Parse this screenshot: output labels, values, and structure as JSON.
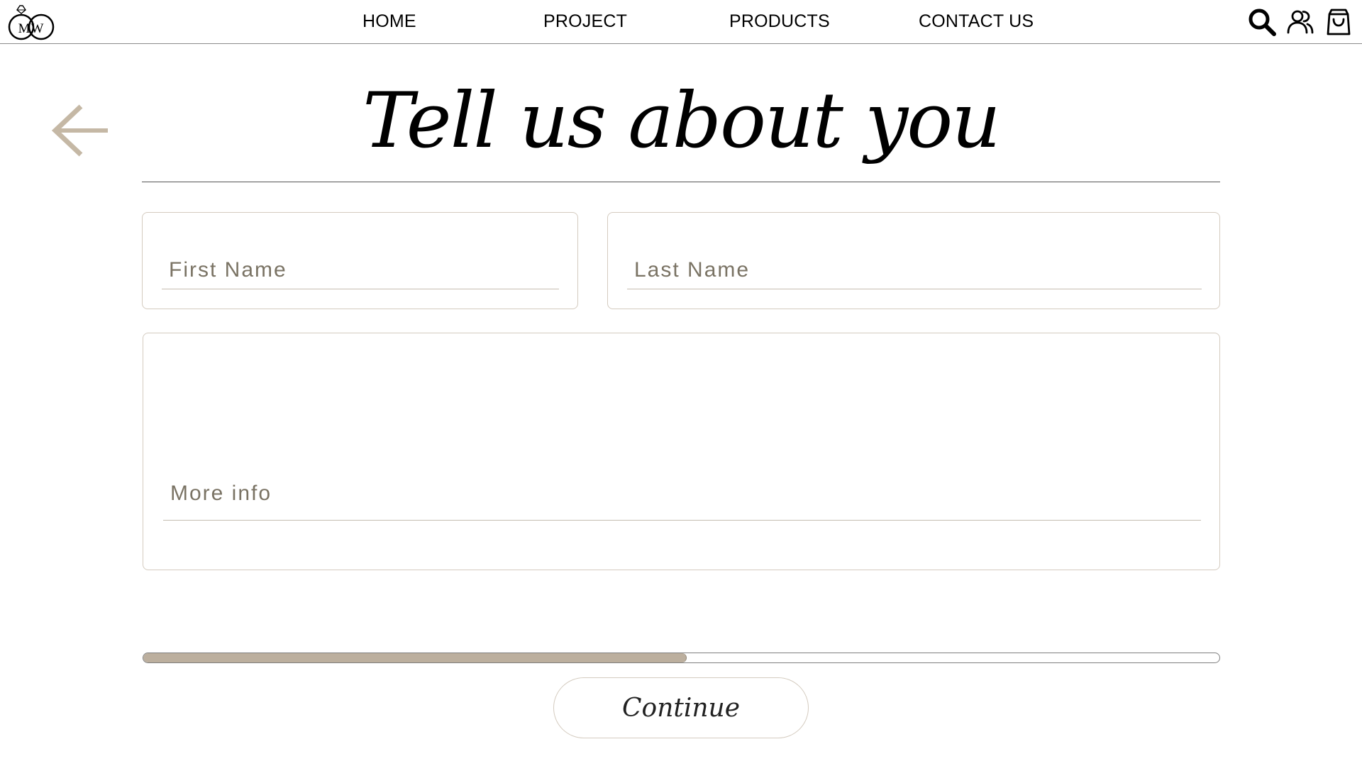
{
  "header": {
    "logo": {
      "text": "MW",
      "icon": "ring-monogram-logo"
    },
    "nav": [
      {
        "label": "HOME"
      },
      {
        "label": "PROJECT"
      },
      {
        "label": "PRODUCTS"
      },
      {
        "label": "CONTACT US"
      }
    ],
    "icons": {
      "search": "search-icon",
      "account": "users-icon",
      "cart": "shopping-bag-icon"
    }
  },
  "page": {
    "back_icon": "arrow-left-icon",
    "title": "Tell us about you",
    "form": {
      "first_name": {
        "placeholder": "First Name",
        "value": ""
      },
      "last_name": {
        "placeholder": "Last Name",
        "value": ""
      },
      "more_info": {
        "placeholder": "More info",
        "value": ""
      }
    },
    "progress": {
      "fraction": 0.505
    },
    "continue_label": "Continue"
  },
  "colors": {
    "accent": "#bcaf9e",
    "field_border": "#d4cbbf",
    "placeholder": "#7a7364",
    "text": "#000000"
  }
}
